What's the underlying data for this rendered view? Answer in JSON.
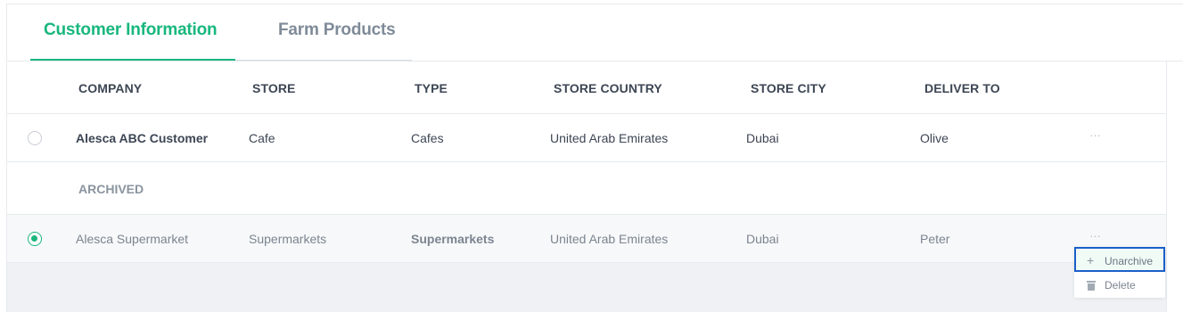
{
  "tabs": [
    {
      "label": "Customer Information",
      "active": true
    },
    {
      "label": "Farm Products",
      "active": false
    }
  ],
  "table": {
    "columns": [
      "COMPANY",
      "STORE",
      "TYPE",
      "STORE COUNTRY",
      "STORE CITY",
      "DELIVER TO"
    ],
    "rows": [
      {
        "company": "Alesca ABC Customer",
        "store": "Cafe",
        "type": "Cafes",
        "country": "United Arab Emirates",
        "city": "Dubai",
        "deliver_to": "Olive",
        "selected": false
      },
      {
        "company": "Alesca Supermarket",
        "store": "Supermarkets",
        "type": "Supermarkets",
        "country": "United Arab Emirates",
        "city": "Dubai",
        "deliver_to": "Peter",
        "selected": true
      }
    ],
    "archived_label": "ARCHIVED",
    "more_icon": "…"
  },
  "row_menu": {
    "unarchive": {
      "label": "Unarchive",
      "icon": "+"
    },
    "delete": {
      "label": "Delete",
      "icon": "trash-icon"
    }
  },
  "colors": {
    "accent": "#18b77e",
    "focus_outline": "#1a5fc9"
  }
}
